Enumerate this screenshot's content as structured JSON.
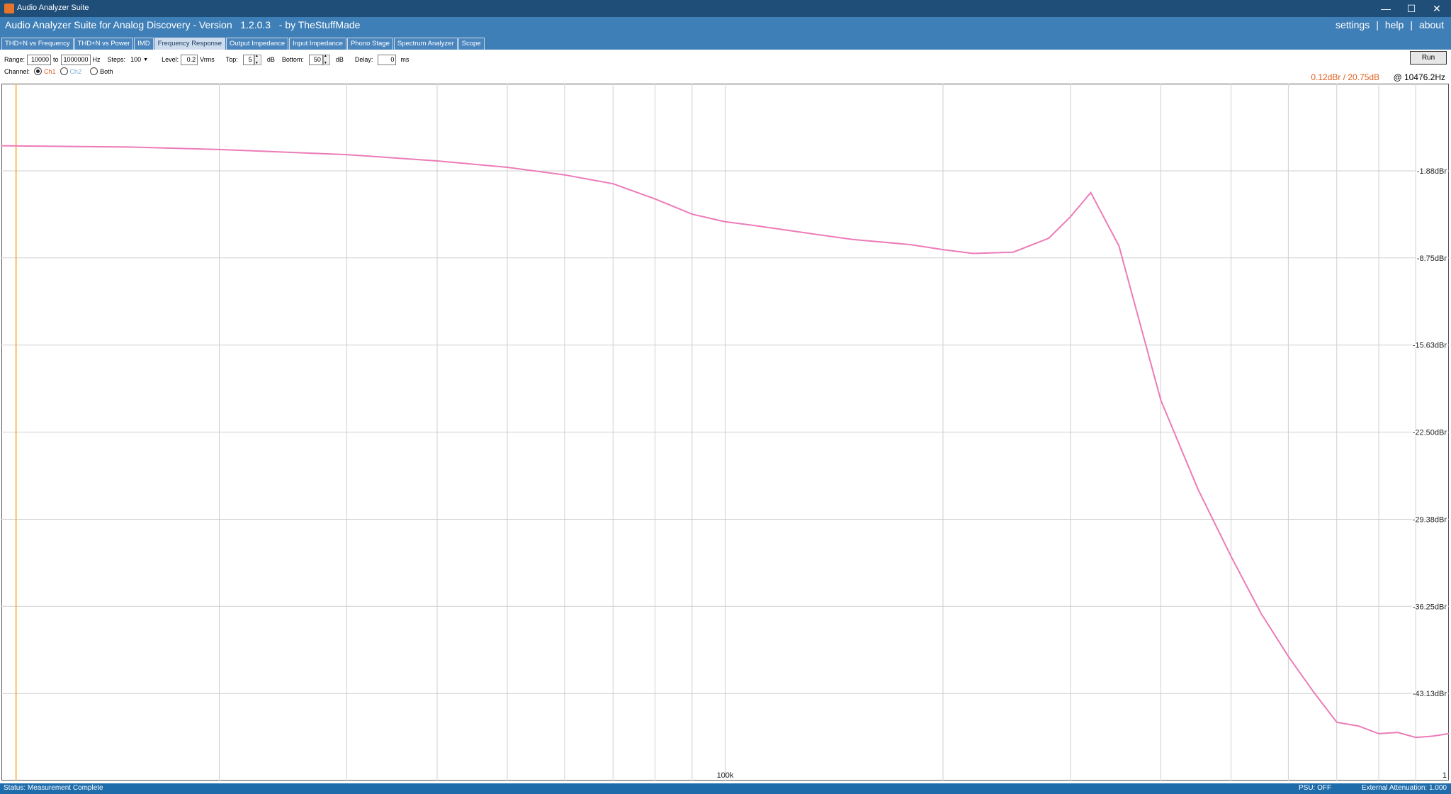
{
  "window": {
    "title": "Audio Analyzer Suite",
    "icon": "waveform-icon",
    "controls": {
      "minimize": "—",
      "maximize": "☐",
      "close": "✕"
    }
  },
  "header": {
    "app_name": "Audio Analyzer Suite for Analog Discovery - Version   1.2.0.3   - by TheStuffMade",
    "menu": {
      "settings": "settings",
      "help": "help",
      "about": "about",
      "separator": "|"
    }
  },
  "tabs": [
    {
      "label": "THD+N vs Frequency",
      "active": false
    },
    {
      "label": "THD+N vs Power",
      "active": false
    },
    {
      "label": "IMD",
      "active": false
    },
    {
      "label": "Frequency Response",
      "active": true
    },
    {
      "label": "Output Impedance",
      "active": false
    },
    {
      "label": "Input Impedance",
      "active": false
    },
    {
      "label": "Phono Stage",
      "active": false
    },
    {
      "label": "Spectrum Analyzer",
      "active": false
    },
    {
      "label": "Scope",
      "active": false
    }
  ],
  "controls": {
    "range_label": "Range:",
    "range_from": "10000",
    "range_to_label": "to",
    "range_to": "1000000",
    "range_unit": "Hz",
    "steps_label": "Steps:",
    "steps_value": "100",
    "level_label": "Level:",
    "level_value": "0.2",
    "level_unit": "Vrms",
    "top_label": "Top:",
    "top_value": "5",
    "top_unit": "dB",
    "bottom_label": "Bottom:",
    "bottom_value": "50",
    "bottom_unit": "dB",
    "delay_label": "Delay:",
    "delay_value": "0",
    "delay_unit": "ms",
    "run_label": "Run"
  },
  "channel": {
    "label": "Channel:",
    "options": [
      {
        "label": "Ch1",
        "selected": true,
        "color": "#e06020"
      },
      {
        "label": "Ch2",
        "selected": false,
        "color": "#7fb0e0"
      },
      {
        "label": "Both",
        "selected": false,
        "color": "#000000"
      }
    ]
  },
  "cursor_readout": {
    "value": "0.12dBr / 20.75dB",
    "freq": "@ 10476.2Hz"
  },
  "chart_data": {
    "type": "line",
    "x_scale": "log",
    "xlim": [
      10000,
      1000000
    ],
    "ylim": [
      -50,
      5
    ],
    "ytick_labels": [
      "-1.88dBr",
      "-8.75dBr",
      "-15.63dBr",
      "-22.50dBr",
      "-29.38dBr",
      "-36.25dBr",
      "-43.13dBr"
    ],
    "ytick_values": [
      -1.88,
      -8.75,
      -15.63,
      -22.5,
      -29.38,
      -36.25,
      -43.13
    ],
    "xtick_labels": [
      "100k",
      "1"
    ],
    "xtick_values": [
      100000,
      1000000
    ],
    "x_gridlines": [
      20000,
      30000,
      40000,
      50000,
      60000,
      70000,
      80000,
      90000,
      100000,
      200000,
      300000,
      400000,
      500000,
      600000,
      700000,
      800000,
      900000
    ],
    "cursor_x": 10476.2,
    "cursor_color": "#f5a623",
    "series_color": "#ec7bb8",
    "x": [
      10000,
      15000,
      20000,
      30000,
      40000,
      50000,
      60000,
      70000,
      80000,
      90000,
      100000,
      110000,
      130000,
      150000,
      180000,
      200000,
      220000,
      250000,
      280000,
      300000,
      320000,
      350000,
      400000,
      450000,
      500000,
      550000,
      600000,
      650000,
      700000,
      750000,
      800000,
      850000,
      900000,
      950000,
      1000000
    ],
    "y": [
      0.1,
      0.0,
      -0.2,
      -0.6,
      -1.1,
      -1.6,
      -2.2,
      -2.9,
      -4.1,
      -5.3,
      -5.9,
      -6.2,
      -6.8,
      -7.3,
      -7.7,
      -8.1,
      -8.4,
      -8.3,
      -7.2,
      -5.5,
      -3.6,
      -7.8,
      -20.0,
      -27.0,
      -32.3,
      -36.8,
      -40.2,
      -43.0,
      -45.4,
      -45.7,
      -46.3,
      -46.2,
      -46.6,
      -46.5,
      -46.3
    ]
  },
  "status": {
    "left": "Status: Measurement Complete",
    "psu": "PSU: OFF",
    "attenuation": "External Attenuation: 1.000"
  }
}
